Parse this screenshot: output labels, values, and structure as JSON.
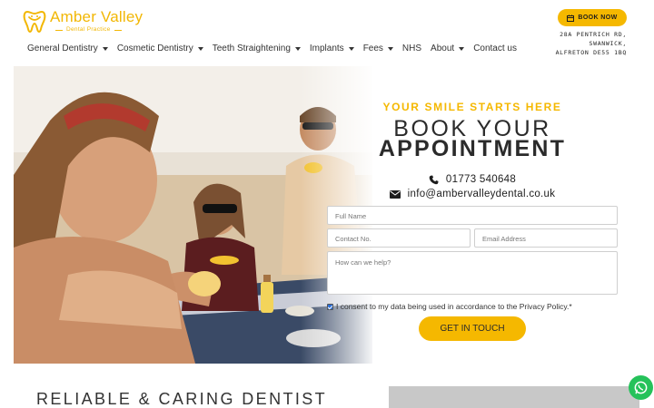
{
  "brand": {
    "name": "Amber Valley",
    "subtitle": "Dental Practice",
    "accent": "#f5b800"
  },
  "nav": {
    "items": [
      {
        "label": "General Dentistry",
        "dropdown": true
      },
      {
        "label": "Cosmetic Dentistry",
        "dropdown": true
      },
      {
        "label": "Teeth Straightening",
        "dropdown": true
      },
      {
        "label": "Implants",
        "dropdown": true
      },
      {
        "label": "Fees",
        "dropdown": true
      },
      {
        "label": "NHS",
        "dropdown": false
      },
      {
        "label": "About",
        "dropdown": true
      },
      {
        "label": "Contact us",
        "dropdown": false
      }
    ]
  },
  "header": {
    "book_now": "BOOK NOW",
    "address_line1": "28A PENTRICH RD,",
    "address_line2": "SWANWICK,",
    "address_line3": "ALFRETON DE55 1BQ"
  },
  "hero": {
    "image_icon": "beach-friends-photo"
  },
  "booking": {
    "tagline": "YOUR SMILE STARTS HERE",
    "heading_line1": "BOOK YOUR",
    "heading_line2": "APPOINTMENT",
    "phone": "01773 540648",
    "email": "info@ambervalleydental.co.uk",
    "fields": {
      "full_name": "Full Name",
      "contact_no": "Contact No.",
      "email_address": "Email Address",
      "message": "How can we help?"
    },
    "consent": "I consent to my data being used in accordance to the Privacy Policy.*",
    "consent_checked": true,
    "submit": "GET IN TOUCH"
  },
  "section": {
    "heading": "RELIABLE & CARING DENTIST"
  },
  "colors": {
    "whatsapp": "#25c25a",
    "checkbox": "#2d6fd6"
  }
}
